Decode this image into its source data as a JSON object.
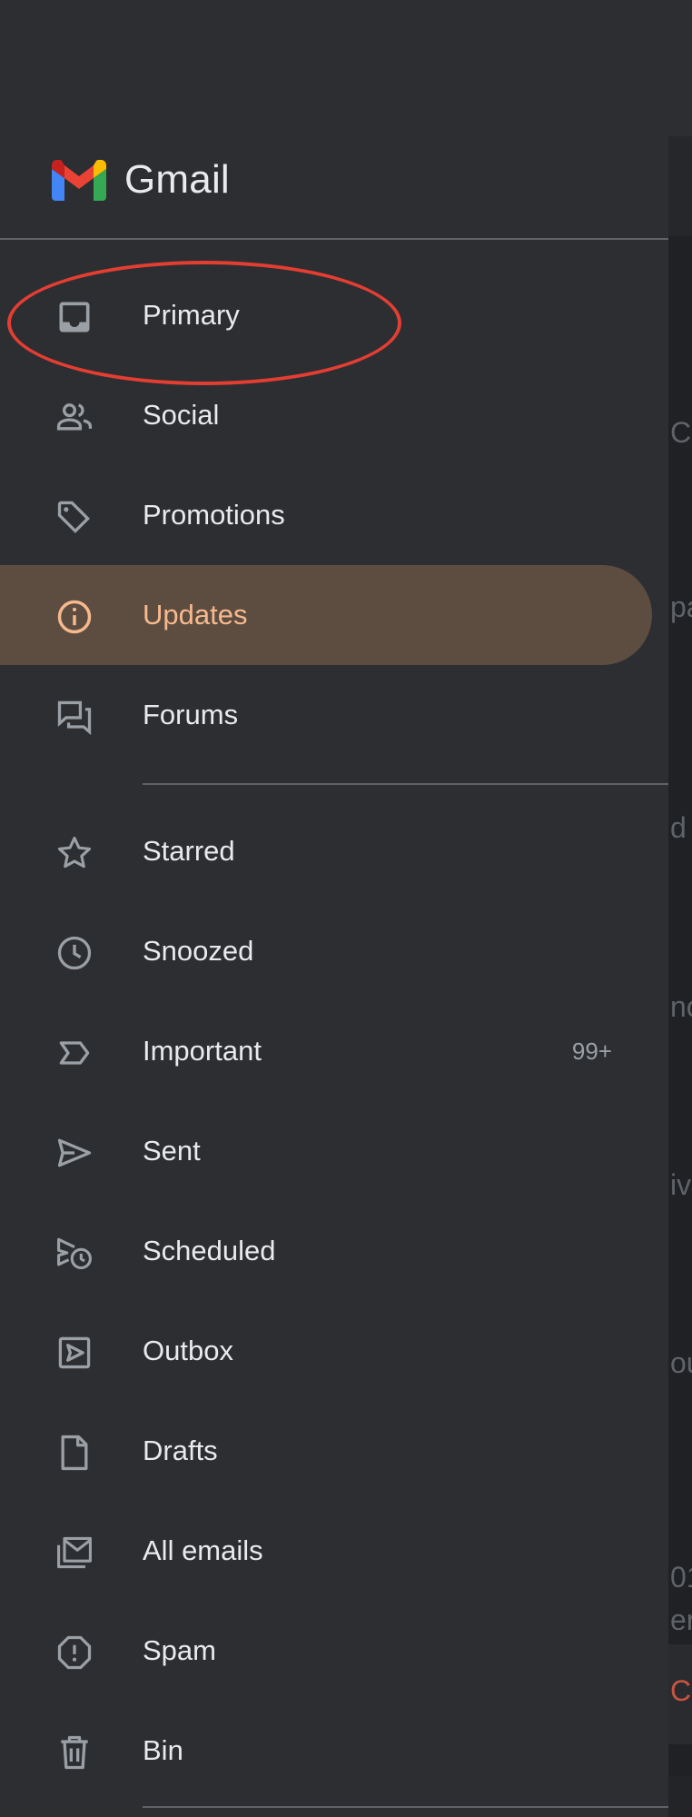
{
  "app": {
    "name": "Gmail"
  },
  "nav": {
    "categories": [
      {
        "label": "Primary",
        "icon": "inbox-icon"
      },
      {
        "label": "Social",
        "icon": "people-icon"
      },
      {
        "label": "Promotions",
        "icon": "tag-icon"
      },
      {
        "label": "Updates",
        "icon": "info-icon",
        "selected": true
      },
      {
        "label": "Forums",
        "icon": "forum-icon"
      }
    ],
    "folders": [
      {
        "label": "Starred",
        "icon": "star-icon"
      },
      {
        "label": "Snoozed",
        "icon": "clock-icon"
      },
      {
        "label": "Important",
        "icon": "important-icon",
        "count": "99+"
      },
      {
        "label": "Sent",
        "icon": "send-icon"
      },
      {
        "label": "Scheduled",
        "icon": "scheduled-send-icon"
      },
      {
        "label": "Outbox",
        "icon": "outbox-icon"
      },
      {
        "label": "Drafts",
        "icon": "draft-icon"
      },
      {
        "label": "All emails",
        "icon": "all-mail-icon"
      },
      {
        "label": "Spam",
        "icon": "spam-icon"
      },
      {
        "label": "Bin",
        "icon": "trash-icon"
      }
    ]
  },
  "background_fragments": [
    "C",
    "pa",
    "d t",
    "nc",
    "ivi",
    "ou",
    "01",
    "er",
    "Cc"
  ],
  "colors": {
    "drawer_bg": "#2d2e31",
    "selected_bg": "#5d4d41",
    "selected_text": "#f6b98e",
    "text": "#e8eaed",
    "icon": "#9aa0a6",
    "annotation": "#e43e33"
  }
}
